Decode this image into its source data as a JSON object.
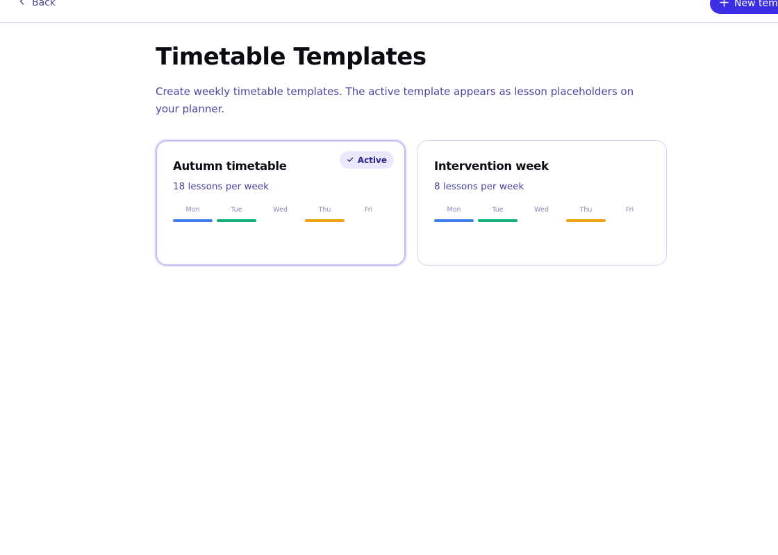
{
  "topbar": {
    "back_label": "Back",
    "new_button_label": "New template"
  },
  "page": {
    "title": "Timetable Templates",
    "description": "Create weekly timetable templates. The active template appears as lesson placeholders on your planner."
  },
  "colors": {
    "accent": "#3b2fe6",
    "mon": "#3d7ee8",
    "tue": "#14b07a",
    "thu": "#f0a010"
  },
  "cards": [
    {
      "title": "Autumn timetable",
      "subtitle": "18 lessons per week",
      "active": true,
      "badge": "Active",
      "days": [
        {
          "label": "Mon",
          "has_lessons": true
        },
        {
          "label": "Tue",
          "has_lessons": true
        },
        {
          "label": "Wed",
          "has_lessons": false
        },
        {
          "label": "Thu",
          "has_lessons": true
        },
        {
          "label": "Fri",
          "has_lessons": false
        }
      ]
    },
    {
      "title": "Intervention week",
      "subtitle": "8 lessons per week",
      "active": false,
      "days": [
        {
          "label": "Mon",
          "has_lessons": true
        },
        {
          "label": "Tue",
          "has_lessons": true
        },
        {
          "label": "Wed",
          "has_lessons": false
        },
        {
          "label": "Thu",
          "has_lessons": true
        },
        {
          "label": "Fri",
          "has_lessons": false
        }
      ]
    }
  ]
}
